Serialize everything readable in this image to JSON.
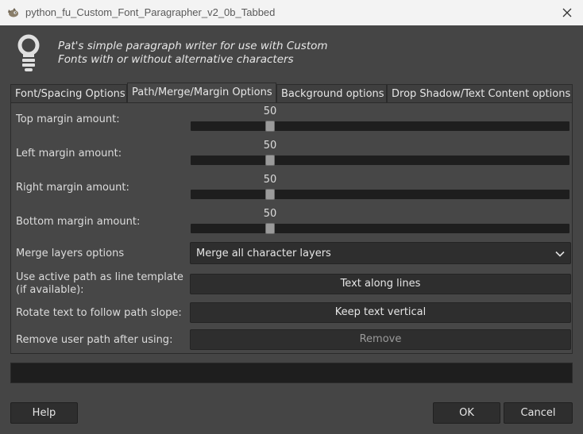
{
  "window": {
    "title": "python_fu_Custom_Font_Paragrapher_v2_0b_Tabbed",
    "app_icon": "gimp-wilber-icon",
    "close_icon": "close-icon"
  },
  "header": {
    "icon": "lightbulb-icon",
    "line1": "Pat's simple paragraph writer for use with Custom",
    "line2": "Fonts with or without alternative characters"
  },
  "tabs": [
    {
      "label": "Font/Spacing Options",
      "active": false
    },
    {
      "label": "Path/Merge/Margin Options",
      "active": true
    },
    {
      "label": "Background options",
      "active": false
    },
    {
      "label": "Drop Shadow/Text Content options",
      "active": false
    }
  ],
  "sliders": [
    {
      "label": "Top margin amount:",
      "value": "50"
    },
    {
      "label": "Left margin amount:",
      "value": "50"
    },
    {
      "label": "Right margin amount:",
      "value": "50"
    },
    {
      "label": "Bottom margin amount:",
      "value": "50"
    }
  ],
  "merge": {
    "label": "Merge layers options",
    "selected": "Merge all character layers",
    "icon": "chevron-down-icon"
  },
  "path_template": {
    "label_line1": "Use active path as line template",
    "label_line2": "(if available):",
    "button": "Text along lines"
  },
  "rotate": {
    "label": "Rotate text to follow path slope:",
    "button": "Keep text vertical"
  },
  "remove_path": {
    "label": "Remove user path after using:",
    "button": "Remove"
  },
  "footer": {
    "help": "Help",
    "ok": "OK",
    "cancel": "Cancel"
  },
  "colors": {
    "background": "#454545",
    "field": "#2e2e2e",
    "track": "#1e1e1e",
    "thumb": "#9a9a9a"
  }
}
